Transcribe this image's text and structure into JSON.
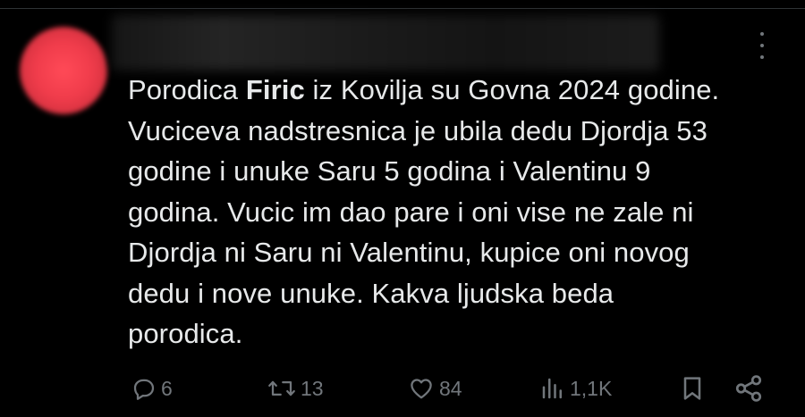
{
  "tweet": {
    "text_line1_pre": "Porodica ",
    "text_line1_bold": "Firic",
    "text_line1_post": " iz Kovilja su Govna 2024 godine.",
    "text_line2": "Vuciceva nadstresnica je ubila dedu Djordja 53",
    "text_line3": "godine i unuke Saru 5 godina i Valentinu 9",
    "text_line4": "godina. Vucic im dao pare i oni vise ne zale ni",
    "text_line5": "Djordja ni Saru ni Valentinu, kupice oni novog",
    "text_line6": "dedu i nove unuke. Kakva ljudska beda",
    "text_line7": "porodica."
  },
  "actions": {
    "replies": "6",
    "reposts": "13",
    "likes": "84",
    "views": "1,1K"
  },
  "icons": {
    "reply": "reply-icon",
    "repost": "repost-icon",
    "like": "heart-icon",
    "views": "views-icon",
    "bookmark": "bookmark-icon",
    "share": "share-icon",
    "more": "more-icon"
  },
  "colors": {
    "background": "#000000",
    "text": "#e7e9ea",
    "muted": "#71767b",
    "avatar": "#f03c4b"
  }
}
